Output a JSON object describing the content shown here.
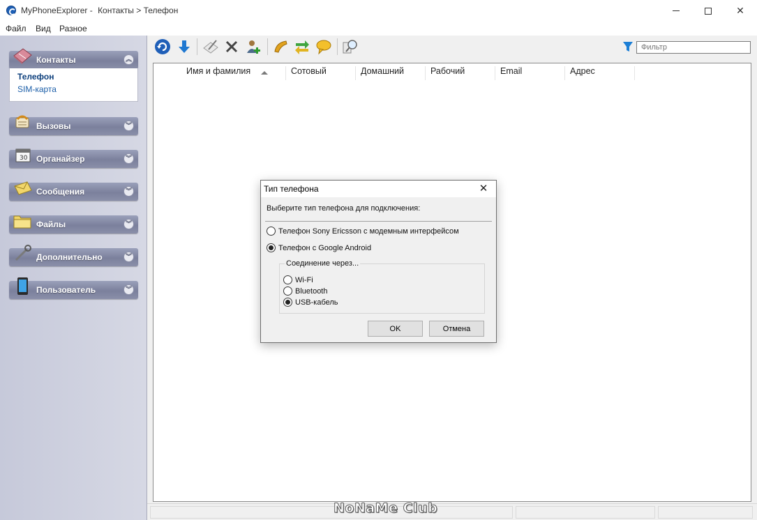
{
  "window": {
    "app_name": "MyPhoneExplorer -",
    "breadcrumb": "Контакты > Телефон"
  },
  "menu": [
    "Файл",
    "Вид",
    "Разное"
  ],
  "sidebar": {
    "groups": [
      {
        "label": "Контакты",
        "icon": "contacts-book-icon",
        "expanded": true
      },
      {
        "label": "Вызовы",
        "icon": "calls-phone-icon"
      },
      {
        "label": "Органайзер",
        "icon": "organizer-calendar-icon"
      },
      {
        "label": "Сообщения",
        "icon": "messages-envelope-icon"
      },
      {
        "label": "Файлы",
        "icon": "files-folder-icon"
      },
      {
        "label": "Дополнительно",
        "icon": "tools-wrench-icon"
      },
      {
        "label": "Пользователь",
        "icon": "user-device-icon"
      }
    ],
    "contacts_items": [
      {
        "label": "Телефон",
        "active": true
      },
      {
        "label": "SIM-карта",
        "active": false
      }
    ]
  },
  "toolbar": {
    "buttons": [
      "refresh-icon",
      "download-icon",
      "edit-icon",
      "delete-icon",
      "add-contact-icon",
      "call-icon",
      "sync-icon",
      "message-icon",
      "search-icon"
    ],
    "filter_placeholder": "Фильтр"
  },
  "list": {
    "columns": [
      "Имя и фамилия",
      "Сотовый",
      "Домашний",
      "Рабочий",
      "Email",
      "Адрес"
    ]
  },
  "dialog": {
    "title": "Тип телефона",
    "prompt": "Выберите тип телефона для подключения:",
    "phone_options": [
      {
        "label": "Телефон Sony Ericsson с модемным интерфейсом",
        "checked": false
      },
      {
        "label": "Телефон с Google Android",
        "checked": true
      }
    ],
    "connection_group_label": "Соединение через...",
    "connection_options": [
      {
        "label": "Wi-Fi",
        "checked": false
      },
      {
        "label": "Bluetooth",
        "checked": false
      },
      {
        "label": "USB-кабель",
        "checked": true
      }
    ],
    "ok_label": "OK",
    "cancel_label": "Отмена"
  },
  "watermark": "NoNaMe Club",
  "colors": {
    "accent_link": "#1b5ea8",
    "sidebar_header": "#7b809c",
    "filter_icon": "#1d7fd6"
  }
}
